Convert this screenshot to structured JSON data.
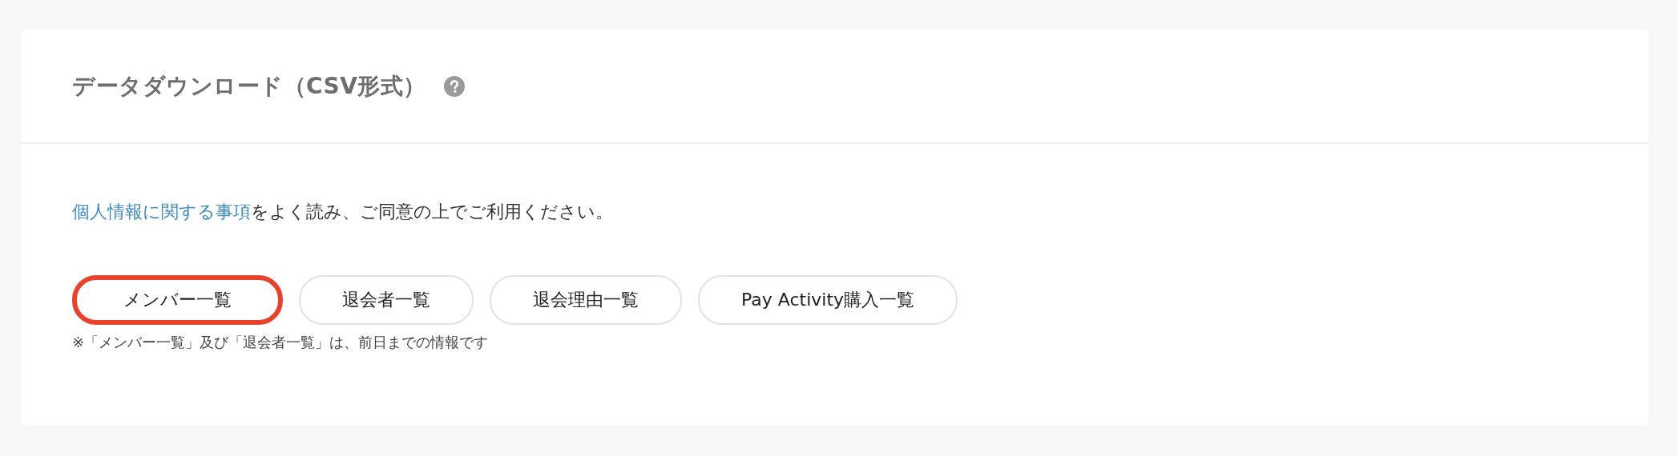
{
  "panel": {
    "title": "データダウンロード（CSV形式）"
  },
  "notice": {
    "link": "個人情報に関する事項",
    "text": "をよく読み、ご同意の上でご利用ください。"
  },
  "buttons": [
    {
      "label": "メンバー一覧",
      "highlighted": true
    },
    {
      "label": "退会者一覧",
      "highlighted": false
    },
    {
      "label": "退会理由一覧",
      "highlighted": false
    },
    {
      "label": "Pay Activity購入一覧",
      "highlighted": false
    }
  ],
  "note": "※「メンバー一覧」及び「退会者一覧」は、前日までの情報です"
}
